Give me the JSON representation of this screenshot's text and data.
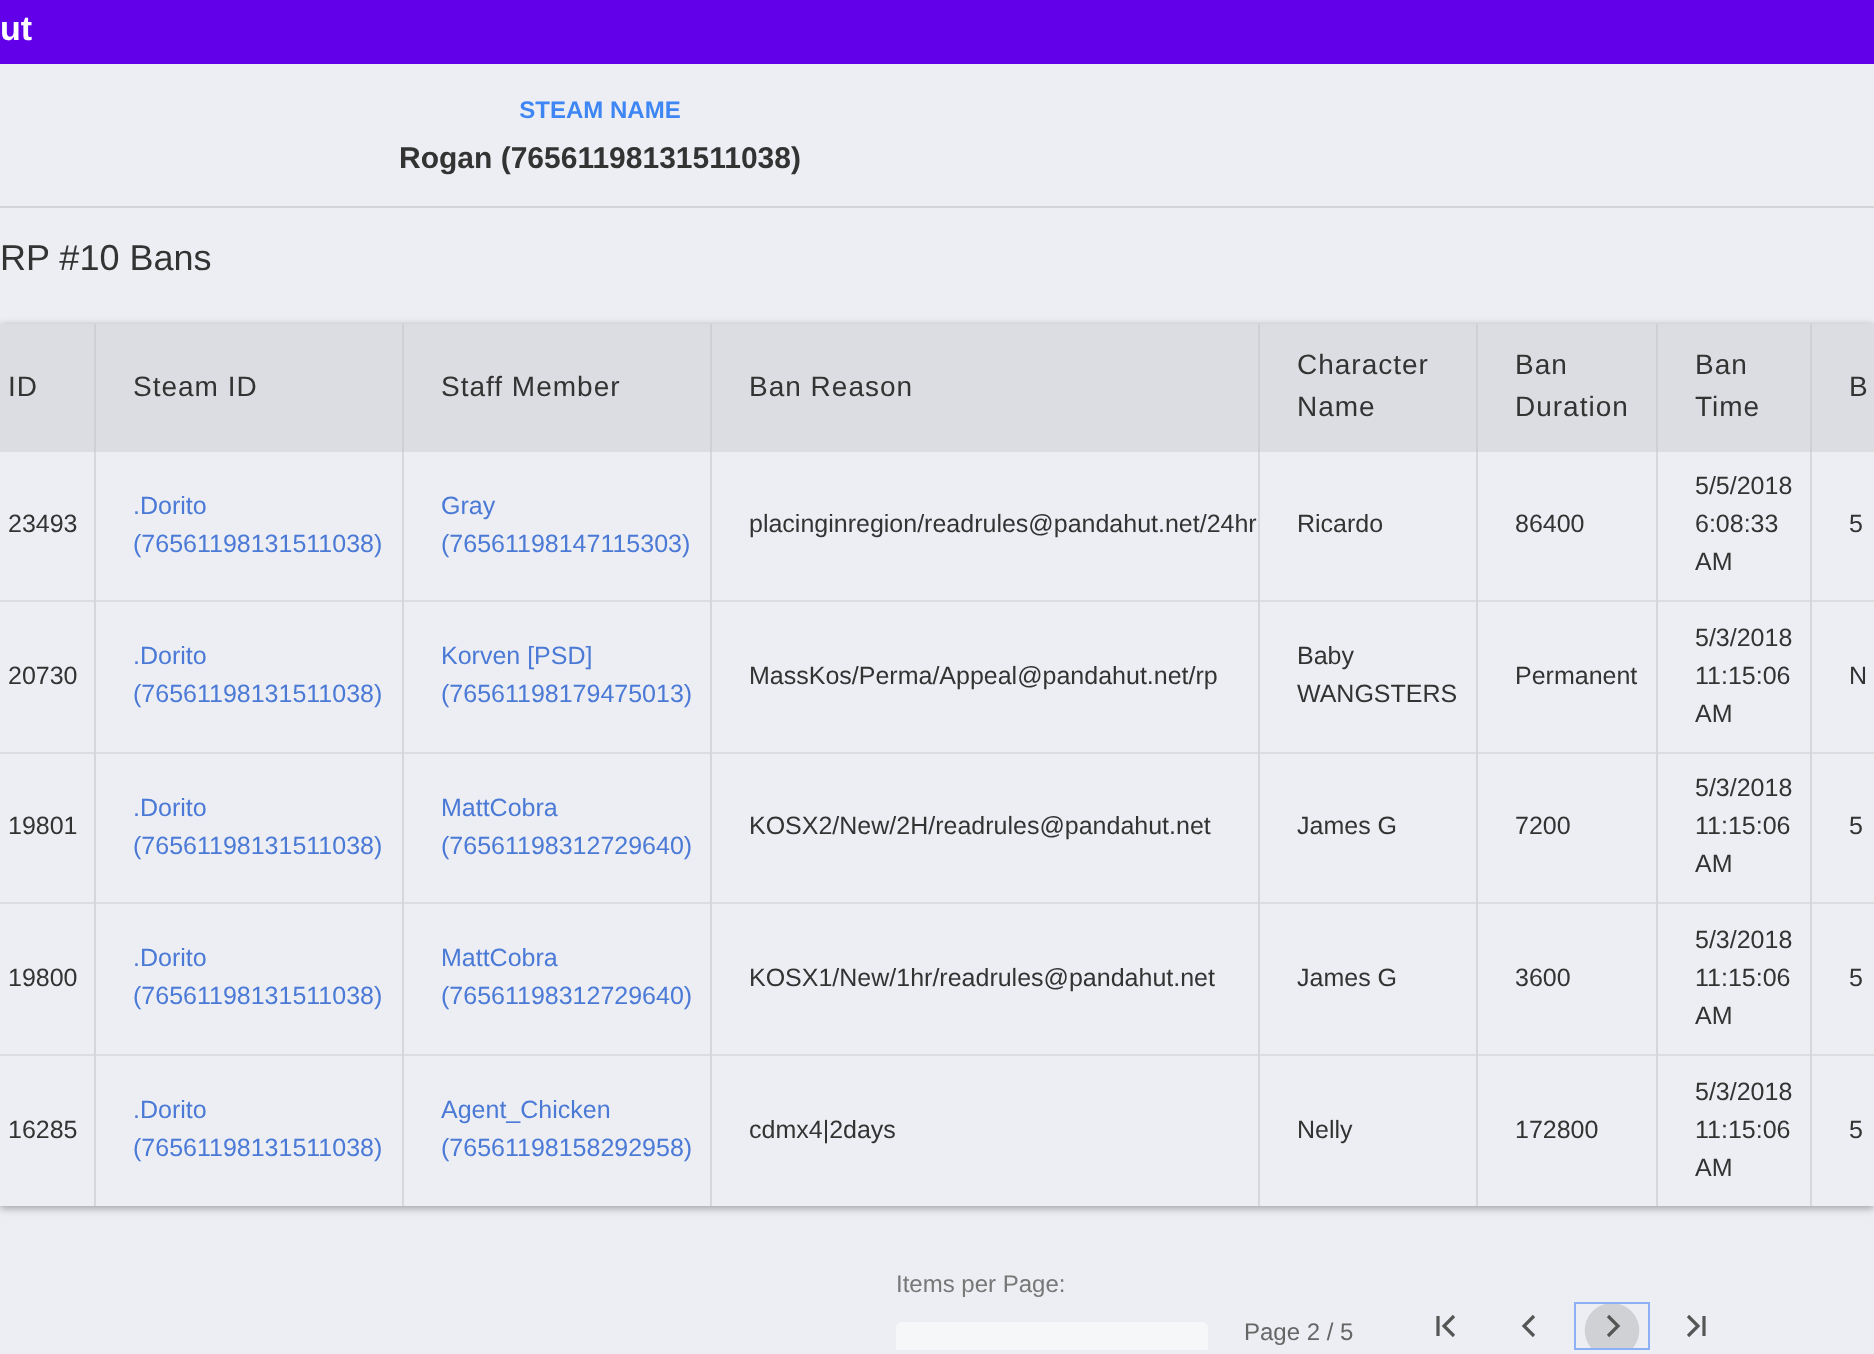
{
  "app_bar": {
    "title": "ut"
  },
  "profile": {
    "label": "STEAM NAME",
    "value": "Rogan (76561198131511038)"
  },
  "section_title": "RP #10 Bans",
  "table": {
    "columns": [
      "ID",
      "Steam ID",
      "Staff Member",
      "Ban Reason",
      "Character Name",
      "Ban Duration",
      "Ban Time",
      "B"
    ],
    "rows": [
      {
        "id": "23493",
        "steam_name": ".Dorito",
        "steam_id": "(76561198131511038)",
        "staff_name": "Gray",
        "staff_id": "(76561198147115303)",
        "reason": "placinginregion/readrules@pandahut.net/24hr",
        "character": "Ricardo",
        "duration": "86400",
        "time": "5/5/2018 6:08:33 AM",
        "column_8": "5"
      },
      {
        "id": "20730",
        "steam_name": ".Dorito",
        "steam_id": "(76561198131511038)",
        "staff_name": "Korven [PSD]",
        "staff_id": "(76561198179475013)",
        "reason": "MassKos/Perma/Appeal@pandahut.net/rp",
        "character": "Baby WANGSTERS",
        "duration": "Permanent",
        "time": "5/3/2018 11:15:06 AM",
        "column_8": "N"
      },
      {
        "id": "19801",
        "steam_name": ".Dorito",
        "steam_id": "(76561198131511038)",
        "staff_name": "MattCobra",
        "staff_id": "(76561198312729640)",
        "reason": "KOSX2/New/2H/readrules@pandahut.net",
        "character": "James G",
        "duration": "7200",
        "time": "5/3/2018 11:15:06 AM",
        "column_8": "5"
      },
      {
        "id": "19800",
        "steam_name": ".Dorito",
        "steam_id": "(76561198131511038)",
        "staff_name": "MattCobra",
        "staff_id": "(76561198312729640)",
        "reason": "KOSX1/New/1hr/readrules@pandahut.net",
        "character": "James G",
        "duration": "3600",
        "time": "5/3/2018 11:15:06 AM",
        "column_8": "5"
      },
      {
        "id": "16285",
        "steam_name": ".Dorito",
        "steam_id": "(76561198131511038)",
        "staff_name": "Agent_Chicken",
        "staff_id": "(76561198158292958)",
        "reason": "cdmx4|2days",
        "character": "Nelly",
        "duration": "172800",
        "time": "5/3/2018 11:15:06 AM",
        "column_8": "5"
      }
    ]
  },
  "pagination": {
    "items_per_page_label": "Items per Page:",
    "page_label": "Page 2 / 5",
    "buttons": [
      {
        "kind": "first",
        "selected": false
      },
      {
        "kind": "prev",
        "selected": false
      },
      {
        "kind": "next",
        "selected": true
      },
      {
        "kind": "last",
        "selected": false
      }
    ]
  }
}
